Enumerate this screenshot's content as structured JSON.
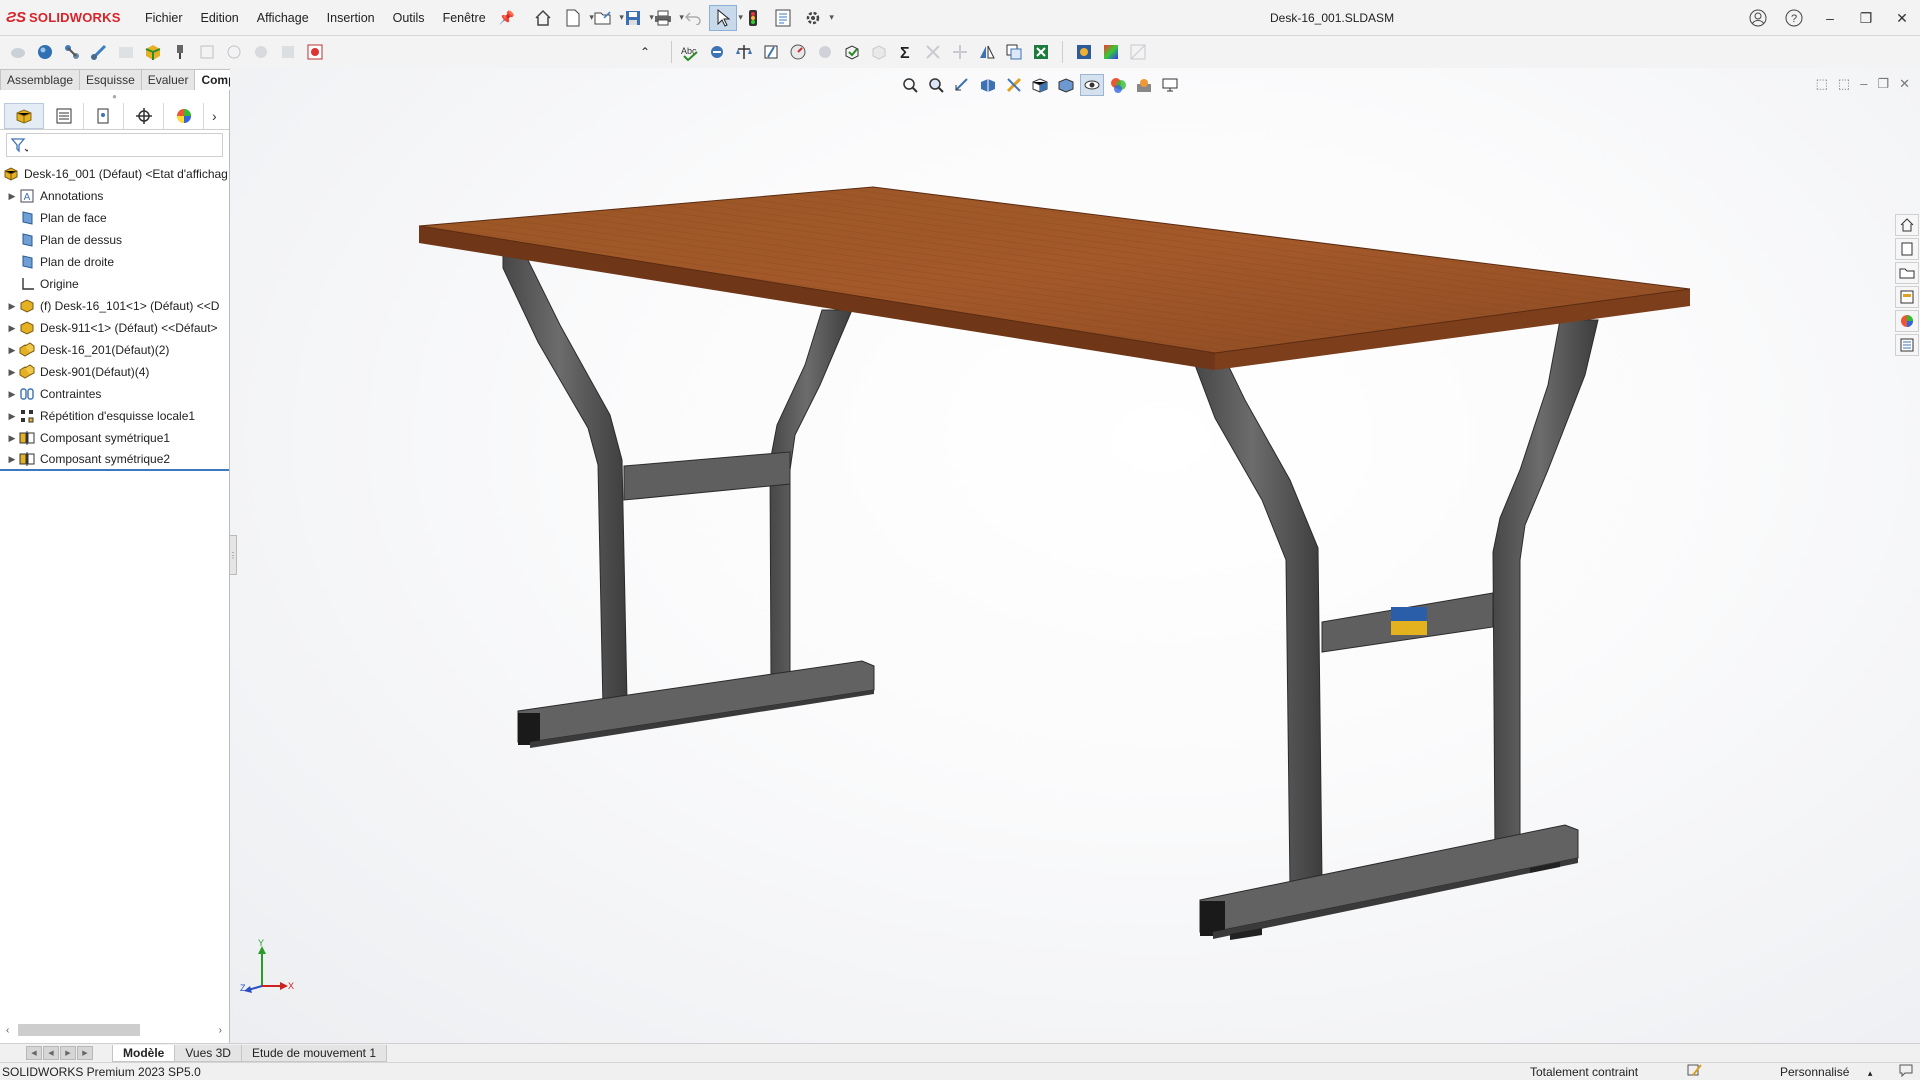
{
  "app": {
    "brand": "SOLIDWORKS",
    "document_title": "Desk-16_001.SLDASM"
  },
  "menu": [
    "Fichier",
    "Edition",
    "Affichage",
    "Insertion",
    "Outils",
    "Fenêtre"
  ],
  "command_tabs": [
    {
      "label": "Assemblage",
      "active": false
    },
    {
      "label": "Esquisse",
      "active": false
    },
    {
      "label": "Evaluer",
      "active": false
    },
    {
      "label": "Compléments de SOLIDWORKS",
      "active": true
    }
  ],
  "feature_tree": {
    "root": "Desk-16_001 (Défaut) <Etat d'affichag",
    "items": [
      {
        "label": "Annotations",
        "icon": "annotations-icon",
        "expandable": true
      },
      {
        "label": "Plan de face",
        "icon": "plane-icon",
        "expandable": false
      },
      {
        "label": "Plan de dessus",
        "icon": "plane-icon",
        "expandable": false
      },
      {
        "label": "Plan de droite",
        "icon": "plane-icon",
        "expandable": false
      },
      {
        "label": "Origine",
        "icon": "origin-icon",
        "expandable": false
      },
      {
        "label": "(f) Desk-16_101<1> (Défaut) <<D",
        "icon": "part-icon",
        "expandable": true
      },
      {
        "label": "Desk-911<1> (Défaut) <<Défaut>",
        "icon": "part-icon",
        "expandable": true
      },
      {
        "label": "Desk-16_201(Défaut)(2)",
        "icon": "assembly-icon",
        "expandable": true
      },
      {
        "label": "Desk-901(Défaut)(4)",
        "icon": "assembly-icon",
        "expandable": true
      },
      {
        "label": "Contraintes",
        "icon": "mates-icon",
        "expandable": true
      },
      {
        "label": "Répétition d'esquisse locale1",
        "icon": "pattern-icon",
        "expandable": true
      },
      {
        "label": "Composant symétrique1",
        "icon": "mirror-icon",
        "expandable": true
      },
      {
        "label": "Composant symétrique2",
        "icon": "mirror-icon",
        "expandable": true
      }
    ]
  },
  "bottom_tabs": [
    {
      "label": "Modèle",
      "active": true
    },
    {
      "label": "Vues 3D",
      "active": false
    },
    {
      "label": "Etude de mouvement 1",
      "active": false
    }
  ],
  "status": {
    "version": "SOLIDWORKS Premium 2023 SP5.0",
    "constraint": "Totalement contraint",
    "units": "Personnalisé"
  },
  "triad": {
    "x": "X",
    "y": "Y",
    "z": "Z"
  },
  "colors": {
    "brand_red": "#d8232a",
    "wood": "#8a4a22",
    "frame": "#5b5b5b",
    "selection_blue": "#3a78c2"
  }
}
